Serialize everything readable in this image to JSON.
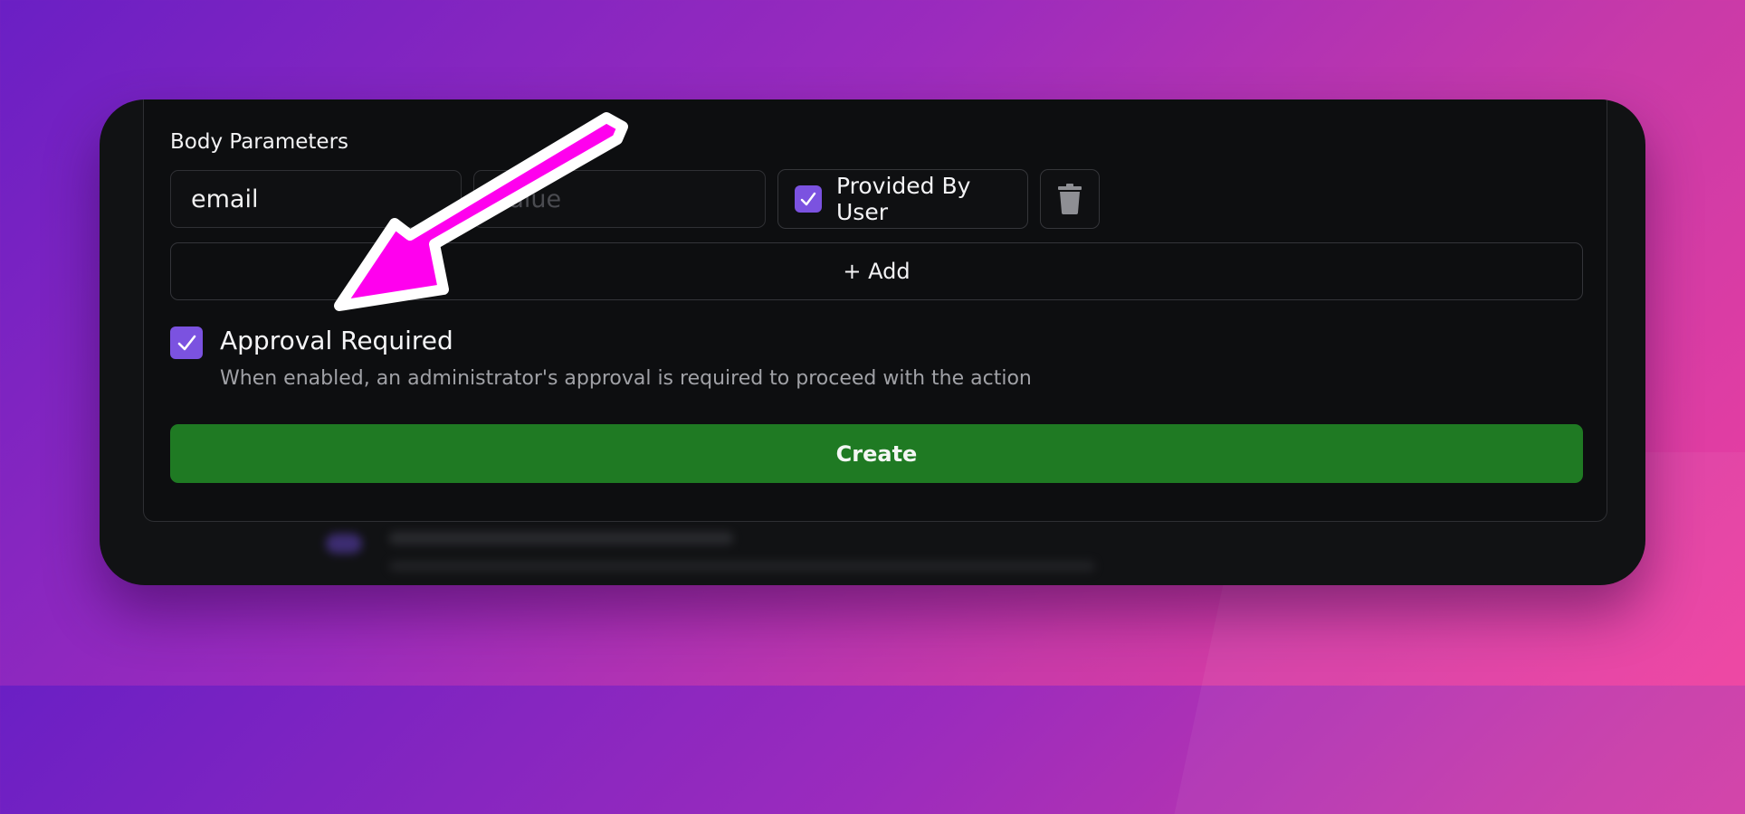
{
  "body_parameters": {
    "label": "Body Parameters",
    "row": {
      "name_value": "email",
      "value_placeholder": "Value",
      "provided_by_user_label": "Provided By User",
      "provided_by_user_checked": true,
      "delete_icon": "trash-icon"
    },
    "add_label": "+ Add"
  },
  "approval": {
    "checked": true,
    "title": "Approval Required",
    "description": "When enabled, an administrator's approval is required to proceed with the action"
  },
  "create_label": "Create",
  "colors": {
    "accent_checkbox": "#7b52e0",
    "create_button": "#1f7a23",
    "annotation_arrow": "#ff00ee"
  }
}
